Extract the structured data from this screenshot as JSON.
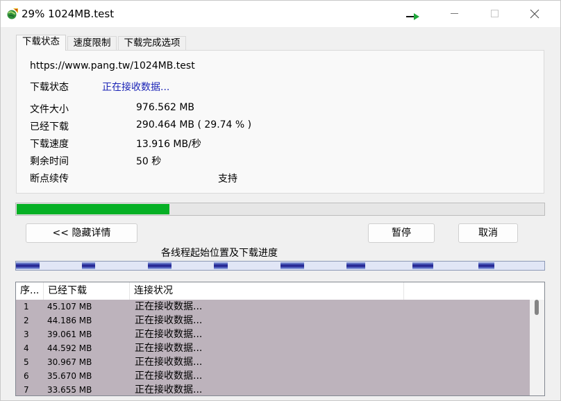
{
  "window": {
    "title": "29% 1024MB.test",
    "controls": {
      "minimize": "minimize",
      "maximize": "maximize",
      "close": "close"
    }
  },
  "tabs": [
    {
      "label": "下载状态",
      "active": true
    },
    {
      "label": "速度限制",
      "active": false
    },
    {
      "label": "下载完成选项",
      "active": false
    }
  ],
  "panel": {
    "url": "https://www.pang.tw/1024MB.test",
    "status_label": "下载状态",
    "status_value": "正在接收数据...",
    "fields": [
      {
        "label": "文件大小",
        "value": "976.562  MB"
      },
      {
        "label": "已经下载",
        "value": "290.464  MB  ( 29.74 % )"
      },
      {
        "label": "下载速度",
        "value": "13.916  MB/秒"
      },
      {
        "label": "剩余时间",
        "value": "50 秒"
      },
      {
        "label": "断点续传",
        "value": "支持"
      }
    ]
  },
  "progress": {
    "fraction": 0.2974,
    "color": "#06b025"
  },
  "buttons": {
    "hide_details": "<< 隐藏详情",
    "pause": "暂停",
    "cancel": "取消"
  },
  "threads": {
    "label": "各线程起始位置及下载进度",
    "segments": [
      {
        "start": 0.0,
        "progress": 0.045
      },
      {
        "start": 0.125,
        "progress": 0.025
      },
      {
        "start": 0.25,
        "progress": 0.045
      },
      {
        "start": 0.375,
        "progress": 0.026
      },
      {
        "start": 0.5,
        "progress": 0.045
      },
      {
        "start": 0.625,
        "progress": 0.036
      },
      {
        "start": 0.75,
        "progress": 0.04
      },
      {
        "start": 0.875,
        "progress": 0.03
      }
    ]
  },
  "list": {
    "columns": [
      "序...",
      "已经下载",
      "连接状况",
      ""
    ],
    "rows": [
      {
        "index": "1",
        "downloaded": "45.107  MB",
        "status": "正在接收数据..."
      },
      {
        "index": "2",
        "downloaded": "44.186  MB",
        "status": "正在接收数据..."
      },
      {
        "index": "3",
        "downloaded": "39.061  MB",
        "status": "正在接收数据..."
      },
      {
        "index": "4",
        "downloaded": "44.592  MB",
        "status": "正在接收数据..."
      },
      {
        "index": "5",
        "downloaded": "30.967  MB",
        "status": "正在接收数据..."
      },
      {
        "index": "6",
        "downloaded": "35.670  MB",
        "status": "正在接收数据..."
      },
      {
        "index": "7",
        "downloaded": "33.655  MB",
        "status": "正在接收数据..."
      }
    ],
    "row_background": "#bdb3bc"
  },
  "icons": {
    "app": "idm-globe-icon",
    "tray": "green-arrow-icon"
  }
}
